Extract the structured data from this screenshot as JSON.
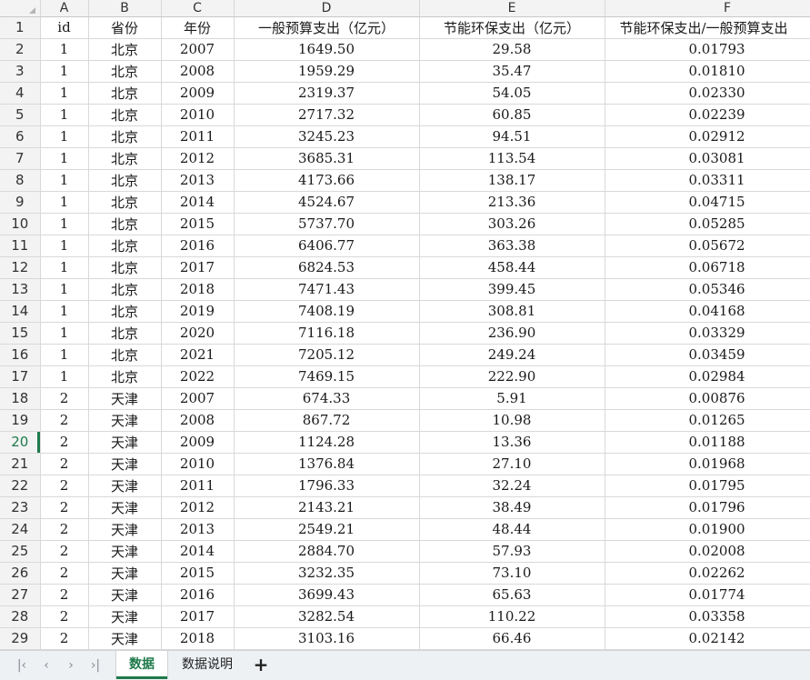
{
  "columns": [
    "A",
    "B",
    "C",
    "D",
    "E",
    "F"
  ],
  "header_row": {
    "row_number": "1",
    "cells": [
      "id",
      "省份",
      "年份",
      "一般预算支出（亿元）",
      "节能环保支出（亿元）",
      "节能环保支出/一般预算支出"
    ]
  },
  "rows": [
    {
      "n": "2",
      "cells": [
        "1",
        "北京",
        "2007",
        "1649.50",
        "29.58",
        "0.01793"
      ]
    },
    {
      "n": "3",
      "cells": [
        "1",
        "北京",
        "2008",
        "1959.29",
        "35.47",
        "0.01810"
      ]
    },
    {
      "n": "4",
      "cells": [
        "1",
        "北京",
        "2009",
        "2319.37",
        "54.05",
        "0.02330"
      ]
    },
    {
      "n": "5",
      "cells": [
        "1",
        "北京",
        "2010",
        "2717.32",
        "60.85",
        "0.02239"
      ]
    },
    {
      "n": "6",
      "cells": [
        "1",
        "北京",
        "2011",
        "3245.23",
        "94.51",
        "0.02912"
      ]
    },
    {
      "n": "7",
      "cells": [
        "1",
        "北京",
        "2012",
        "3685.31",
        "113.54",
        "0.03081"
      ]
    },
    {
      "n": "8",
      "cells": [
        "1",
        "北京",
        "2013",
        "4173.66",
        "138.17",
        "0.03311"
      ]
    },
    {
      "n": "9",
      "cells": [
        "1",
        "北京",
        "2014",
        "4524.67",
        "213.36",
        "0.04715"
      ]
    },
    {
      "n": "10",
      "cells": [
        "1",
        "北京",
        "2015",
        "5737.70",
        "303.26",
        "0.05285"
      ]
    },
    {
      "n": "11",
      "cells": [
        "1",
        "北京",
        "2016",
        "6406.77",
        "363.38",
        "0.05672"
      ]
    },
    {
      "n": "12",
      "cells": [
        "1",
        "北京",
        "2017",
        "6824.53",
        "458.44",
        "0.06718"
      ]
    },
    {
      "n": "13",
      "cells": [
        "1",
        "北京",
        "2018",
        "7471.43",
        "399.45",
        "0.05346"
      ]
    },
    {
      "n": "14",
      "cells": [
        "1",
        "北京",
        "2019",
        "7408.19",
        "308.81",
        "0.04168"
      ]
    },
    {
      "n": "15",
      "cells": [
        "1",
        "北京",
        "2020",
        "7116.18",
        "236.90",
        "0.03329"
      ]
    },
    {
      "n": "16",
      "cells": [
        "1",
        "北京",
        "2021",
        "7205.12",
        "249.24",
        "0.03459"
      ]
    },
    {
      "n": "17",
      "cells": [
        "1",
        "北京",
        "2022",
        "7469.15",
        "222.90",
        "0.02984"
      ]
    },
    {
      "n": "18",
      "cells": [
        "2",
        "天津",
        "2007",
        "674.33",
        "5.91",
        "0.00876"
      ]
    },
    {
      "n": "19",
      "cells": [
        "2",
        "天津",
        "2008",
        "867.72",
        "10.98",
        "0.01265"
      ]
    },
    {
      "n": "20",
      "cells": [
        "2",
        "天津",
        "2009",
        "1124.28",
        "13.36",
        "0.01188"
      ]
    },
    {
      "n": "21",
      "cells": [
        "2",
        "天津",
        "2010",
        "1376.84",
        "27.10",
        "0.01968"
      ]
    },
    {
      "n": "22",
      "cells": [
        "2",
        "天津",
        "2011",
        "1796.33",
        "32.24",
        "0.01795"
      ]
    },
    {
      "n": "23",
      "cells": [
        "2",
        "天津",
        "2012",
        "2143.21",
        "38.49",
        "0.01796"
      ]
    },
    {
      "n": "24",
      "cells": [
        "2",
        "天津",
        "2013",
        "2549.21",
        "48.44",
        "0.01900"
      ]
    },
    {
      "n": "25",
      "cells": [
        "2",
        "天津",
        "2014",
        "2884.70",
        "57.93",
        "0.02008"
      ]
    },
    {
      "n": "26",
      "cells": [
        "2",
        "天津",
        "2015",
        "3232.35",
        "73.10",
        "0.02262"
      ]
    },
    {
      "n": "27",
      "cells": [
        "2",
        "天津",
        "2016",
        "3699.43",
        "65.63",
        "0.01774"
      ]
    },
    {
      "n": "28",
      "cells": [
        "2",
        "天津",
        "2017",
        "3282.54",
        "110.22",
        "0.03358"
      ]
    },
    {
      "n": "29",
      "cells": [
        "2",
        "天津",
        "2018",
        "3103.16",
        "66.46",
        "0.02142"
      ]
    }
  ],
  "active_row": "20",
  "tabs": {
    "first_icon": "first-sheet-icon",
    "prev_icon": "prev-sheet-icon",
    "next_icon": "next-sheet-icon",
    "last_icon": "last-sheet-icon",
    "sheets": [
      "数据",
      "数据说明"
    ],
    "active_sheet": "数据",
    "add_icon": "add-sheet-icon"
  },
  "colors": {
    "accent": "#1f7a4a",
    "grid": "#d9d9d9",
    "header_bg": "#f3f3f3"
  }
}
